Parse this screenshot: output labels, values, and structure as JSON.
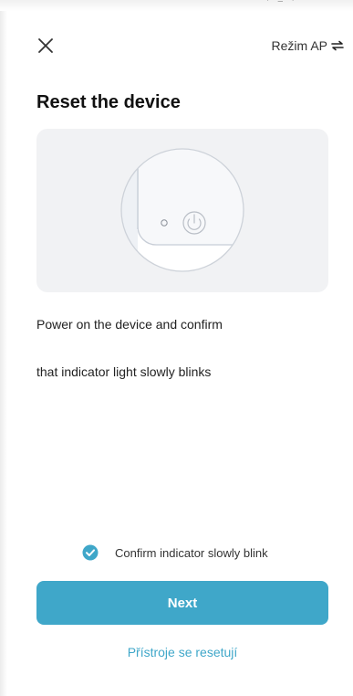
{
  "status_bar": {
    "fragment": "∙ ≡ ∙"
  },
  "header": {
    "close_icon": "close-icon",
    "mode_label": "Režim AP",
    "mode_icon": "switch-arrows-icon"
  },
  "main": {
    "title": "Reset the device",
    "illustration": {
      "description_icon": "device-power-button-icon",
      "card_color": "#f1f2f4"
    },
    "instructions": [
      "Power on the device and confirm",
      "that indicator light slowly blinks"
    ]
  },
  "confirm": {
    "checked": true,
    "label": "Confirm indicator slowly blink",
    "icon": "check-circle-icon"
  },
  "actions": {
    "next_label": "Next",
    "reset_link": "Přístroje se resetují"
  },
  "colors": {
    "accent": "#3fa7c9",
    "text": "#222222",
    "card_background": "#f1f2f4"
  }
}
